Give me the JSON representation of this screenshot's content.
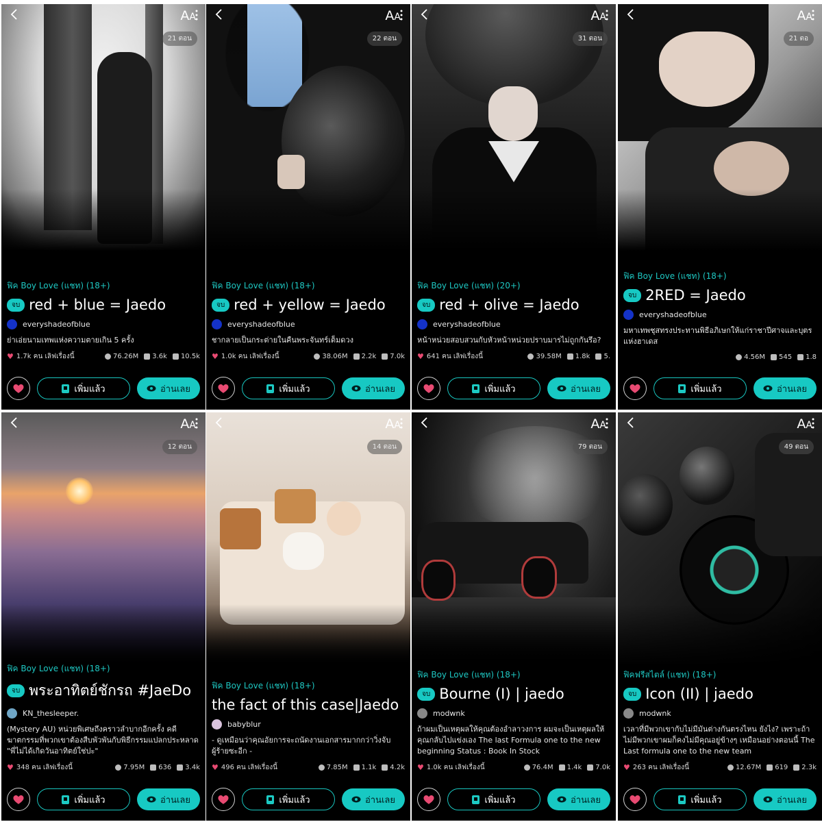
{
  "ui": {
    "aa_large": "A",
    "aa_small": "A",
    "add_label": "เพิ่มแล้ว",
    "read_label": "อ่านเลย",
    "done_badge": "จบ"
  },
  "colors": {
    "accent": "#17c9c3",
    "heart": "#e84a72",
    "background": "#000000"
  },
  "icons": [
    "back-arrow-icon",
    "font-size-icon",
    "more-vertical-icon",
    "heart-icon",
    "book-icon",
    "eye-icon",
    "views-icon",
    "comments-icon",
    "chapters-icon"
  ],
  "panels": [
    {
      "episodes": "21 ตอน",
      "tag": "ฟิค Boy Love (แชท)  (18+)",
      "done": true,
      "title": "red + blue = Jaedo",
      "author": "everyshadeofblue",
      "description": "ย่าเอ่ยนามเทพแห่งความตายเกิน 5 ครั้ง",
      "likes": "1.7k คน เลิฟเรื่องนี้",
      "views": "76.26M",
      "comments": "3.6k",
      "chapters": "10.5k"
    },
    {
      "episodes": "22 ตอน",
      "tag": "ฟิค Boy Love (แชท)  (18+)",
      "done": true,
      "title": "red + yellow = Jaedo",
      "author": "everyshadeofblue",
      "description": "ชากลายเป็นกระต่ายในคืนพระจันทร์เต็มดวง",
      "likes": "1.0k คน เลิฟเรื่องนี้",
      "views": "38.06M",
      "comments": "2.2k",
      "chapters": "7.0k"
    },
    {
      "episodes": "31 ตอน",
      "tag": "ฟิค Boy Love (แชท)  (20+)",
      "done": true,
      "title": "red + olive = Jaedo",
      "author": "everyshadeofblue",
      "description": "หน้าหน่วยสอบสวนกับหัวหน้าหน่วยปราบมารไม่ถูกกันรึอ?",
      "likes": "641 คน เลิฟเรื่องนี้",
      "views": "39.58M",
      "comments": "1.8k",
      "chapters": "5."
    },
    {
      "episodes": "21 ตอ",
      "tag": "ฟิค Boy Love (แชท)  (18+)",
      "done": true,
      "title": "2RED = Jaedo",
      "author": "everyshadeofblue",
      "description": "มหาเทพชุสทรงประทานพิธีอภิเษกให้แก่ราชาปีศาจและบุตรแห่งฮาเดส",
      "likes": "",
      "views": "4.56M",
      "comments": "545",
      "chapters": "1.8"
    },
    {
      "episodes": "12 ตอน",
      "tag": "ฟิค Boy Love (แชท)  (18+)",
      "done": true,
      "title": "พระอาทิตย์ชักรถ #JaeDo",
      "author": "KN_thesleeper.",
      "description": "(Mystery AU) หน่วยพิเศษถึงคราวลำบากอีกครั้ง คดีฆาตกรรมที่พวกเขาต้องสืบพัวพันกับพิธีกรรมแปลกประหลาด \"พี่ไม่ได้เกิดวันอาทิตย์ใช่ปะ\"",
      "likes": "348 คน เลิฟเรื่องนี้",
      "views": "7.95M",
      "comments": "636",
      "chapters": "3.4k"
    },
    {
      "episodes": "14 ตอน",
      "tag": "ฟิค Boy Love (แชท)  (18+)",
      "done": false,
      "title": "the fact of this case|Jaedo",
      "author": "babyblur",
      "description": "- ดูเหมือนว่าคุณอัยการจะถนัดงานเอกสารมากกว่าวิ่งจับผู้ร้ายซะอีก -",
      "likes": "496 คน เลิฟเรื่องนี้",
      "views": "7.85M",
      "comments": "1.1k",
      "chapters": "4.2k"
    },
    {
      "episodes": "79 ตอน",
      "tag": "ฟิค Boy Love (แชท)  (18+)",
      "done": true,
      "title": "Bourne (I) | jaedo",
      "author": "modwnk",
      "description": "ถ้าผมเป็นเหตุผลให้คุณต้องอำลาวงการ ผมจะเป็นเหตุผลให้คุณกลับไปแข่งเอง The last Formula one to the new beginning\nStatus : Book In Stock",
      "likes": "1.0k คน เลิฟเรื่องนี้",
      "views": "76.4M",
      "comments": "1.4k",
      "chapters": "7.0k"
    },
    {
      "episodes": "49 ตอน",
      "tag": "ฟิคฟรีสไตล์ (แชท)  (18+)",
      "done": true,
      "title": "Icon (II) | jaedo",
      "author": "modwnk",
      "description": "เวลาที่มีพวกเขากับไม่มีมันต่างกันตรงไหน ยังไง? เพราะถ้าไม่มีพวกเขาผมก็คงไม่มีคุณอยู่ข้างๆ เหมือนอย่างตอนนี้ The Last formula one to the new team",
      "likes": "263 คน เลิฟเรื่องนี้",
      "views": "12.67M",
      "comments": "619",
      "chapters": "2.3k"
    }
  ]
}
